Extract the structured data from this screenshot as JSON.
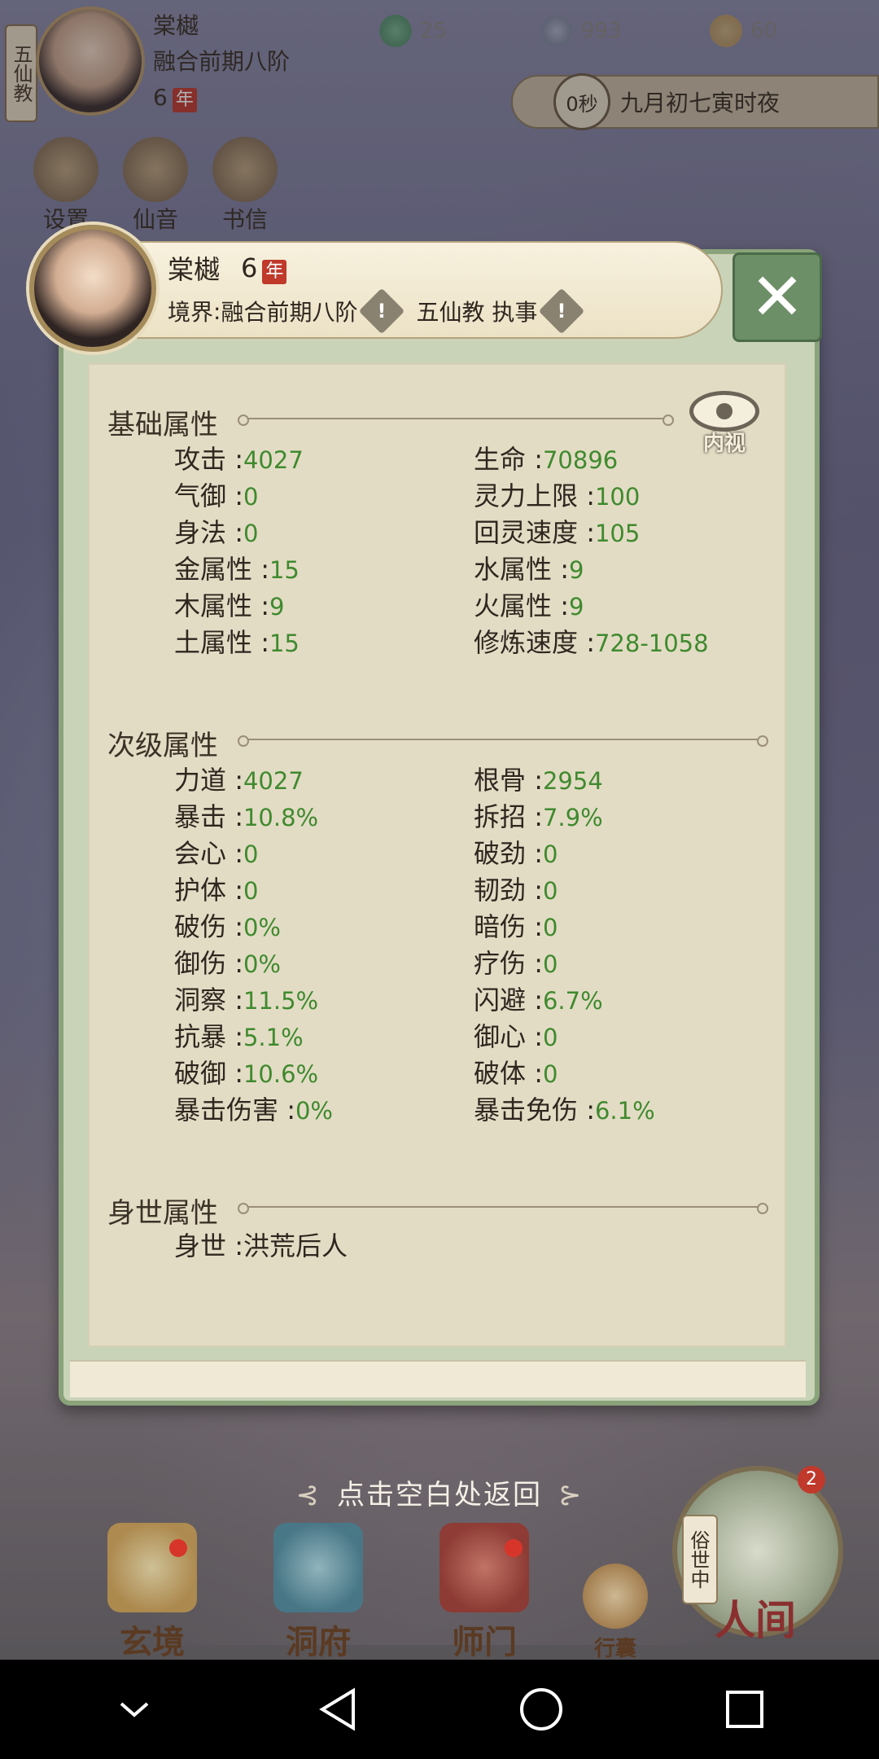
{
  "top": {
    "sect_tag": "五仙教",
    "name": "棠樾",
    "realm": "融合前期八阶",
    "age": "6",
    "year_badge": "年",
    "currency": [
      {
        "icon": "jade-icon",
        "value": "25",
        "color": "#3b9a4b"
      },
      {
        "icon": "coin-icon",
        "value": "993",
        "color": "#7e8b9a"
      },
      {
        "icon": "gourd-icon",
        "value": "60",
        "color": "#d6a23a"
      }
    ],
    "timer": "0秒",
    "date_text": "九月初七寅时夜",
    "icons": [
      {
        "label": "设置",
        "icon": "settings-icon"
      },
      {
        "label": "仙音",
        "icon": "music-icon"
      },
      {
        "label": "书信",
        "icon": "letter-icon"
      }
    ]
  },
  "header": {
    "name": "棠樾",
    "age": "6",
    "year_badge": "年",
    "realm_label": "境界",
    "realm_value": "融合前期八阶",
    "sect_role": "五仙教 执事",
    "inner_view": "内视"
  },
  "sections": {
    "basic": {
      "title": "基础属性",
      "left": [
        {
          "k": "攻击",
          "v": "4027"
        },
        {
          "k": "气御",
          "v": "0"
        },
        {
          "k": "身法",
          "v": "0"
        },
        {
          "k": "金属性",
          "v": "15"
        },
        {
          "k": "木属性",
          "v": "9"
        },
        {
          "k": "土属性",
          "v": "15"
        }
      ],
      "right": [
        {
          "k": "生命",
          "v": "70896"
        },
        {
          "k": "灵力上限",
          "v": "100"
        },
        {
          "k": "回灵速度",
          "v": "105"
        },
        {
          "k": "水属性",
          "v": "9"
        },
        {
          "k": "火属性",
          "v": "9"
        },
        {
          "k": "修炼速度",
          "v": "728-1058"
        }
      ]
    },
    "secondary": {
      "title": "次级属性",
      "left": [
        {
          "k": "力道",
          "v": "4027"
        },
        {
          "k": "暴击",
          "v": "10.8%"
        },
        {
          "k": "会心",
          "v": "0"
        },
        {
          "k": "护体",
          "v": "0"
        },
        {
          "k": "破伤",
          "v": "0%"
        },
        {
          "k": "御伤",
          "v": "0%"
        },
        {
          "k": "洞察",
          "v": "11.5%"
        },
        {
          "k": "抗暴",
          "v": "5.1%"
        },
        {
          "k": "破御",
          "v": "10.6%"
        },
        {
          "k": "暴击伤害",
          "v": "0%"
        }
      ],
      "right": [
        {
          "k": "根骨",
          "v": "2954"
        },
        {
          "k": "拆招",
          "v": "7.9%"
        },
        {
          "k": "破劲",
          "v": "0"
        },
        {
          "k": "韧劲",
          "v": "0"
        },
        {
          "k": "暗伤",
          "v": "0"
        },
        {
          "k": "疗伤",
          "v": "0"
        },
        {
          "k": "闪避",
          "v": "6.7%"
        },
        {
          "k": "御心",
          "v": "0"
        },
        {
          "k": "破体",
          "v": "0"
        },
        {
          "k": "暴击免伤",
          "v": "6.1%"
        }
      ]
    },
    "origin": {
      "title": "身世属性",
      "left": [
        {
          "k": "身世",
          "v": "洪荒后人"
        }
      ]
    }
  },
  "return_hint": "点击空白处返回",
  "bottom_nav": {
    "items": [
      {
        "label": "玄境",
        "icon": "mystic-realm-icon"
      },
      {
        "label": "洞府",
        "icon": "cave-icon"
      },
      {
        "label": "师门",
        "icon": "sect-banner-icon"
      },
      {
        "label": "行囊",
        "icon": "bag-icon"
      }
    ],
    "world_label": "人间",
    "world_tag": "俗世中",
    "notification_count": "2"
  },
  "system_nav": [
    "collapse-icon",
    "back-icon",
    "home-icon",
    "recents-icon"
  ],
  "colors": {
    "value_green": "#3f8a2e",
    "panel_border": "#8aa37a",
    "close_bg": "#6d8f67"
  }
}
